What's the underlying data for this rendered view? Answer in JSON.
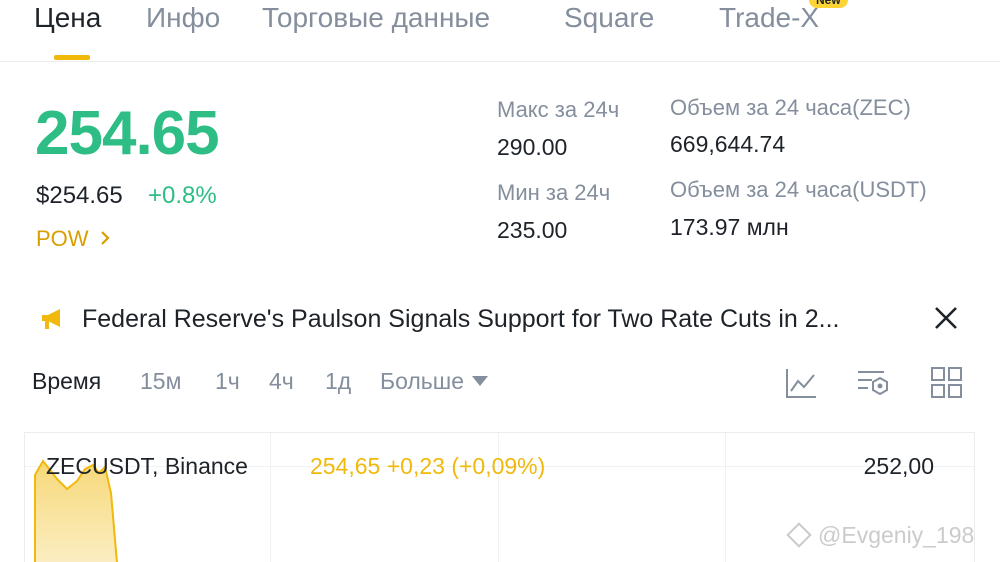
{
  "tabs": [
    {
      "label": "Цена",
      "active": true
    },
    {
      "label": "Инфо",
      "active": false
    },
    {
      "label": "Торговые данные",
      "active": false
    },
    {
      "label": "Square",
      "active": false
    },
    {
      "label": "Trade-X",
      "active": false,
      "badge": "New"
    }
  ],
  "price": {
    "last": "254.65",
    "usd": "$254.65",
    "change": "+0.8%",
    "tag": "POW",
    "color_up": "#2ebd85"
  },
  "stats": {
    "high_label": "Макс за 24ч",
    "high_value": "290.00",
    "low_label": "Мин за 24ч",
    "low_value": "235.00",
    "vol_base_label": "Объем за 24 часа(ZEC)",
    "vol_base_value": "669,644.74",
    "vol_quote_label": "Объем за 24 часа(USDT)",
    "vol_quote_value": "173.97 млн"
  },
  "news": {
    "icon": "megaphone-icon",
    "text": "Federal Reserve's Paulson Signals Support for Two Rate Cuts in 2..."
  },
  "intervals": {
    "items": [
      {
        "label": "Время",
        "active": true
      },
      {
        "label": "15м",
        "active": false
      },
      {
        "label": "1ч",
        "active": false
      },
      {
        "label": "4ч",
        "active": false
      },
      {
        "label": "1д",
        "active": false
      }
    ],
    "more_label": "Больше",
    "tools": [
      "line-chart-icon",
      "indicator-settings-icon",
      "grid-layout-icon"
    ]
  },
  "chart": {
    "symbol": "ZECUSDT, Binance",
    "quote": "254,65  +0,23 (+0,09%)",
    "axis_label": "252,00",
    "accent": "#f0b90b"
  },
  "watermark": "@Evgeniy_198"
}
